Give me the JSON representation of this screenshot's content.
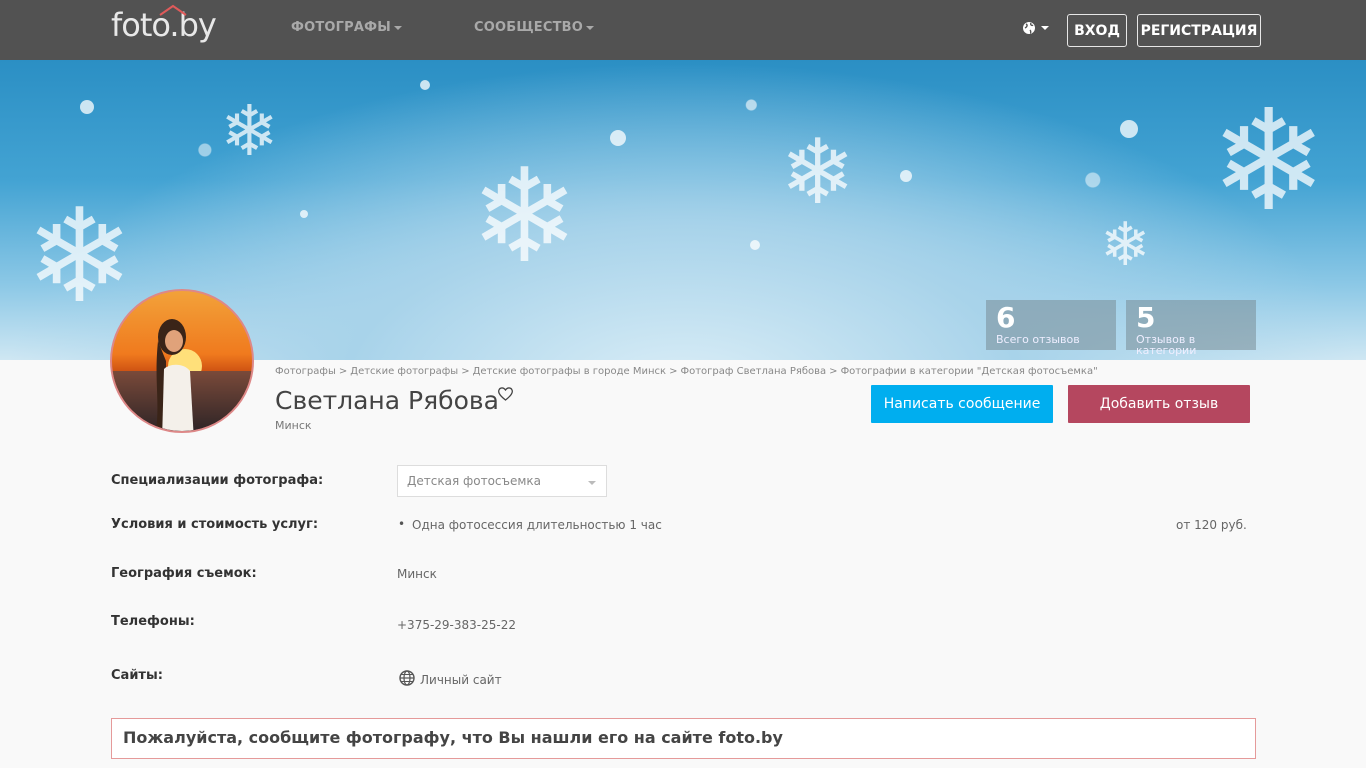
{
  "header": {
    "logo": "foto.by",
    "nav": [
      {
        "label": "ФОТОГРАФЫ"
      },
      {
        "label": "СООБЩЕСТВО"
      }
    ],
    "login": "ВХОД",
    "register": "РЕГИСТРАЦИЯ"
  },
  "stats": [
    {
      "value": "6",
      "label": "Всего отзывов"
    },
    {
      "value": "5",
      "label": "Отзывов в категории"
    }
  ],
  "breadcrumb": [
    "Фотографы",
    "Детские фотографы",
    "Детские фотографы в городе Минск",
    "Фотограф Светлана Рябова",
    "Фотографии в категории \"Детская фотосъемка\""
  ],
  "breadcrumb_separator": ">",
  "profile": {
    "name": "Светлана Рябова",
    "city": "Минск",
    "message_button": "Написать сообщение",
    "review_button": "Добавить отзыв"
  },
  "info": {
    "specializations_label": "Специализации фотографа:",
    "specialization_selected": "Детская фотосъемка",
    "services_label": "Условия и стоимость услуг:",
    "service_name": "Одна фотосессия длительностью 1 час",
    "service_price": "от 120 руб.",
    "geography_label": "География съемок:",
    "geography_value": "Минск",
    "phones_label": "Телефоны:",
    "phone_value": "+375-29-383-25-22",
    "sites_label": "Сайты:",
    "site_value": "Личный сайт"
  },
  "notice": "Пожалуйста, сообщите фотографу, что Вы нашли его на сайте foto.by",
  "colors": {
    "topbar": "#525252",
    "message_button": "#00aeef",
    "review_button": "#b5475f",
    "notice_border": "#e59a9a"
  }
}
